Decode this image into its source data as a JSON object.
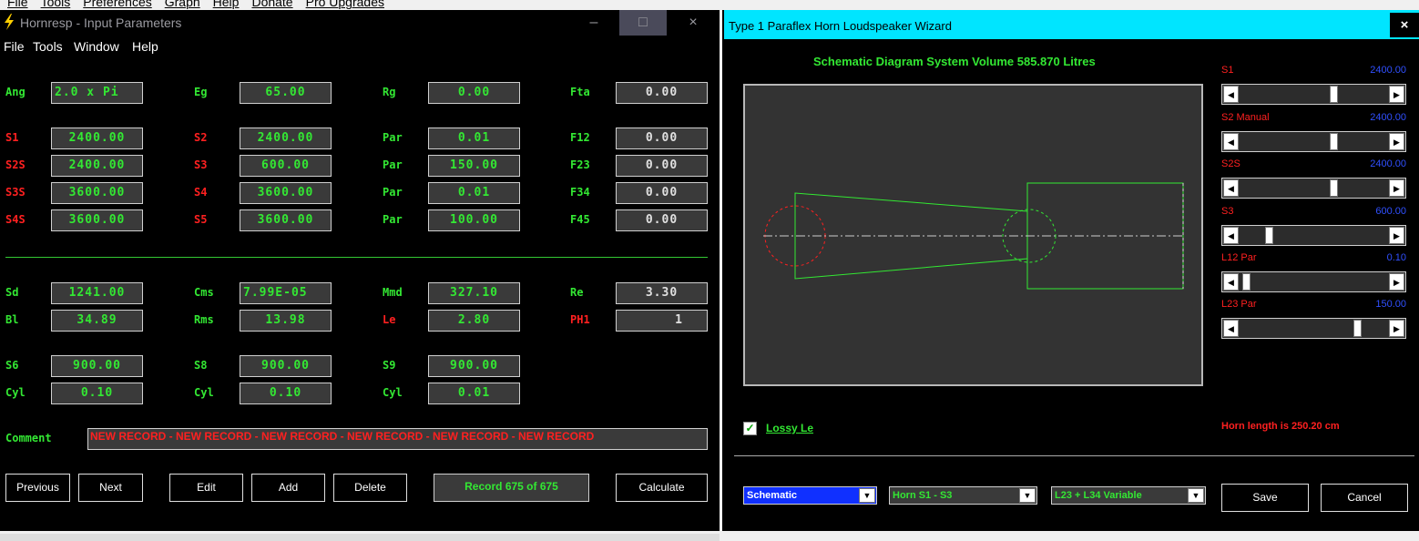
{
  "top_menu": [
    "File",
    "Tools",
    "Preferences",
    "Graph",
    "Help",
    "Donate",
    "Pro Upgrades"
  ],
  "left_window": {
    "title": "Hornresp - Input Parameters",
    "minimize": "–",
    "maximize": "□",
    "close": "×",
    "menu": [
      "File",
      "Tools",
      "Window",
      "Help"
    ],
    "row_ang": {
      "c1": {
        "label": "Ang",
        "value": "2.0 x Pi"
      },
      "c2": {
        "label": "Eg",
        "value": "65.00"
      },
      "c3": {
        "label": "Rg",
        "value": "0.00"
      },
      "c4": {
        "label": "Fta",
        "value": "0.00"
      }
    },
    "rows_s": [
      {
        "c1": {
          "label": "S1",
          "value": "2400.00"
        },
        "c2": {
          "label": "S2",
          "value": "2400.00"
        },
        "c3": {
          "label": "Par",
          "value": "0.01"
        },
        "c4": {
          "label": "F12",
          "value": "0.00"
        }
      },
      {
        "c1": {
          "label": "S2S",
          "value": "2400.00"
        },
        "c2": {
          "label": "S3",
          "value": "600.00"
        },
        "c3": {
          "label": "Par",
          "value": "150.00"
        },
        "c4": {
          "label": "F23",
          "value": "0.00"
        }
      },
      {
        "c1": {
          "label": "S3S",
          "value": "3600.00"
        },
        "c2": {
          "label": "S4",
          "value": "3600.00"
        },
        "c3": {
          "label": "Par",
          "value": "0.01"
        },
        "c4": {
          "label": "F34",
          "value": "0.00"
        }
      },
      {
        "c1": {
          "label": "S4S",
          "value": "3600.00"
        },
        "c2": {
          "label": "S5",
          "value": "3600.00"
        },
        "c3": {
          "label": "Par",
          "value": "100.00"
        },
        "c4": {
          "label": "F45",
          "value": "0.00"
        }
      }
    ],
    "rows_driver": [
      {
        "c1": {
          "label": "Sd",
          "value": "1241.00"
        },
        "c2": {
          "label": "Cms",
          "value": "7.99E-05"
        },
        "c3": {
          "label": "Mmd",
          "value": "327.10"
        },
        "c4": {
          "label": "Re",
          "value": "3.30"
        }
      },
      {
        "c1": {
          "label": "Bl",
          "value": "34.89"
        },
        "c2": {
          "label": "Rms",
          "value": "13.98"
        },
        "c3": {
          "label": "Le",
          "value": "2.80"
        },
        "c4": {
          "label": "PH1",
          "value": "1"
        }
      }
    ],
    "rows_chamber": [
      {
        "c1": {
          "label": "S6",
          "value": "900.00"
        },
        "c2": {
          "label": "S8",
          "value": "900.00"
        },
        "c3": {
          "label": "S9",
          "value": "900.00"
        }
      },
      {
        "c1": {
          "label": "Cyl",
          "value": "0.10"
        },
        "c2": {
          "label": "Cyl",
          "value": "0.10"
        },
        "c3": {
          "label": "Cyl",
          "value": "0.01"
        }
      }
    ],
    "comment_label": "Comment",
    "comment_value": "NEW RECORD - NEW RECORD - NEW RECORD - NEW RECORD - NEW RECORD - NEW RECORD",
    "buttons": {
      "previous": "Previous",
      "next": "Next",
      "edit": "Edit",
      "add": "Add",
      "delete": "Delete",
      "calculate": "Calculate"
    },
    "record": "Record 675 of 675"
  },
  "right_window": {
    "title": "Type 1 Paraflex Horn Loudspeaker Wizard",
    "close": "×",
    "schematic_title": "Schematic Diagram   System Volume 585.870 Litres",
    "sliders": [
      {
        "label": "S1",
        "value": "2400.00",
        "position": 0.64
      },
      {
        "label": "S2  Manual",
        "value": "2400.00",
        "position": 0.64
      },
      {
        "label": "S2S",
        "value": "2400.00",
        "position": 0.64
      },
      {
        "label": "S3",
        "value": "600.00",
        "position": 0.18
      },
      {
        "label": "L12  Par",
        "value": "0.10",
        "position": 0.02
      },
      {
        "label": "L23  Par",
        "value": "150.00",
        "position": 0.81
      }
    ],
    "lossy_label": "Lossy Le",
    "lossy_checked": "✓",
    "horn_length": "Horn length is 250.20 cm",
    "dropdowns": [
      "Schematic",
      "Horn S1 - S3",
      "L23 + L34 Variable"
    ],
    "dropdown_arrow": "▼",
    "save": "Save",
    "cancel": "Cancel"
  },
  "colors": {
    "green": "#33e833",
    "red": "#ff2020",
    "blue_value": "#3050ff",
    "cyan_title": "#00e5ff"
  }
}
